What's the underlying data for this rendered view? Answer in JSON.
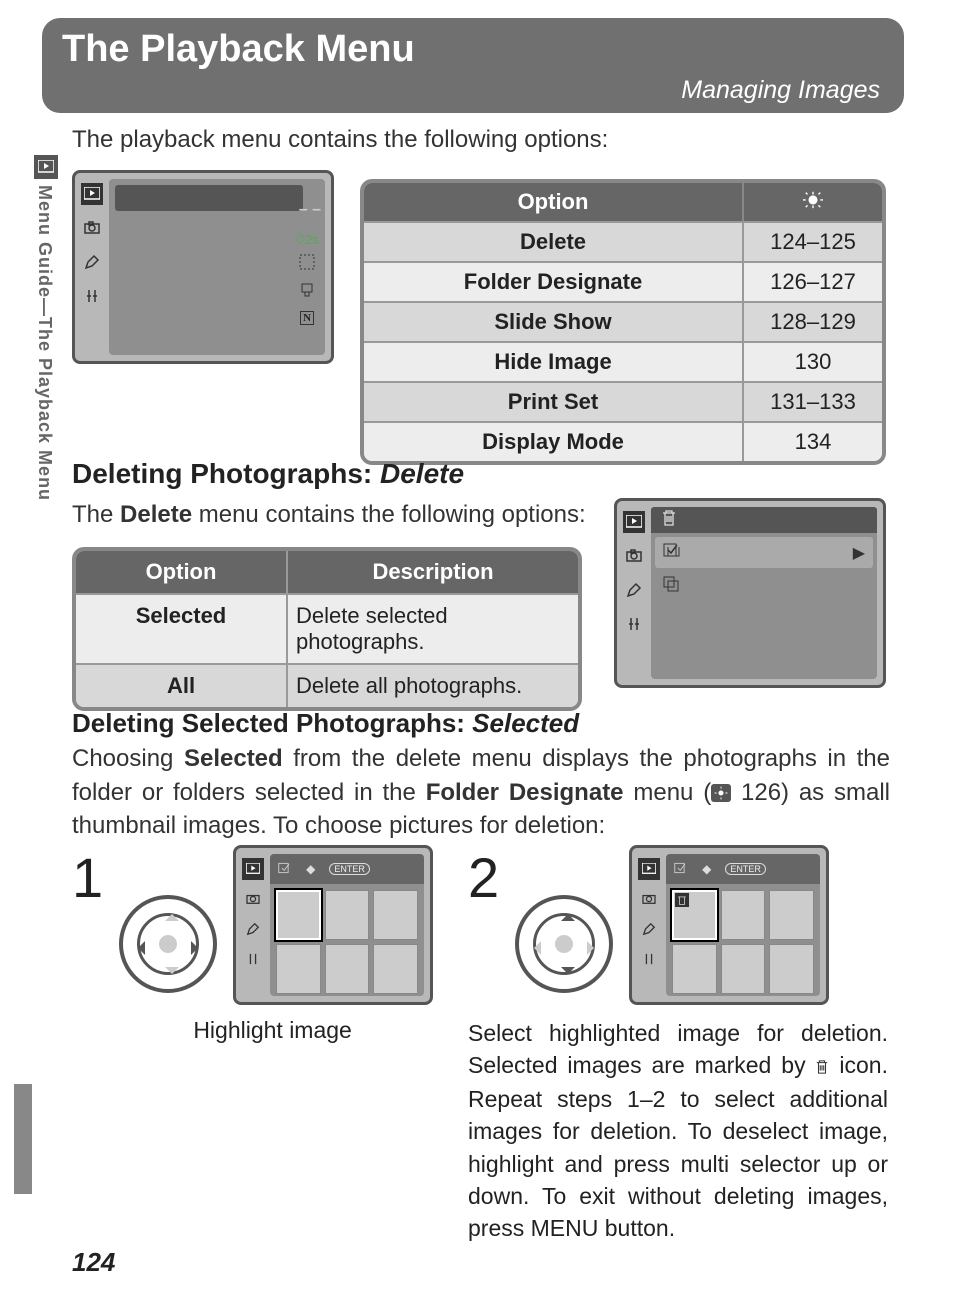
{
  "header": {
    "title": "The Playback Menu",
    "subtitle": "Managing Images"
  },
  "sidebar": {
    "label": "Menu Guide—The Playback Menu"
  },
  "intro": "The playback menu contains the following options:",
  "options_table": {
    "head_option": "Option",
    "rows": [
      {
        "label": "Delete",
        "pages": "124–125"
      },
      {
        "label": "Folder Designate",
        "pages": "126–127"
      },
      {
        "label": "Slide Show",
        "pages": "128–129"
      },
      {
        "label": "Hide Image",
        "pages": "130"
      },
      {
        "label": "Print Set",
        "pages": "131–133"
      },
      {
        "label": "Display Mode",
        "pages": "134"
      }
    ]
  },
  "section_delete": {
    "heading_prefix": "Deleting Photographs: ",
    "heading_em": "Delete",
    "intro_pre": "The ",
    "intro_bold": "Delete",
    "intro_post": " menu contains the following options:"
  },
  "delete_table": {
    "head_option": "Option",
    "head_desc": "Description",
    "rows": [
      {
        "opt": "Selected",
        "desc": "Delete selected photographs."
      },
      {
        "opt": "All",
        "desc": "Delete all photographs."
      }
    ]
  },
  "section_selected": {
    "heading_prefix": "Deleting Selected Photographs: ",
    "heading_em": "Selected",
    "para_1a": "Choosing ",
    "para_1b": "Selected",
    "para_1c": " from the delete menu displays the photographs in the folder or folders selected in the ",
    "para_1d": "Folder Designate",
    "para_1e": " menu (",
    "para_1f": " 126) as small thumbnail images.  To choose pictures for deletion:"
  },
  "steps": {
    "s1": {
      "num": "1",
      "caption": "Highlight image"
    },
    "s2": {
      "num": "2",
      "caption_a": "Select highlighted image for deletion. Selected images are marked by ",
      "caption_b": " icon. Repeat steps 1–2 to select additional images for deletion.  To deselect image, highlight and press multi selector up or down.  To exit without deleting images, press MENU button."
    }
  },
  "lcd_labels": {
    "enter": "ENTER",
    "timer": "2s"
  },
  "page_number": "124"
}
